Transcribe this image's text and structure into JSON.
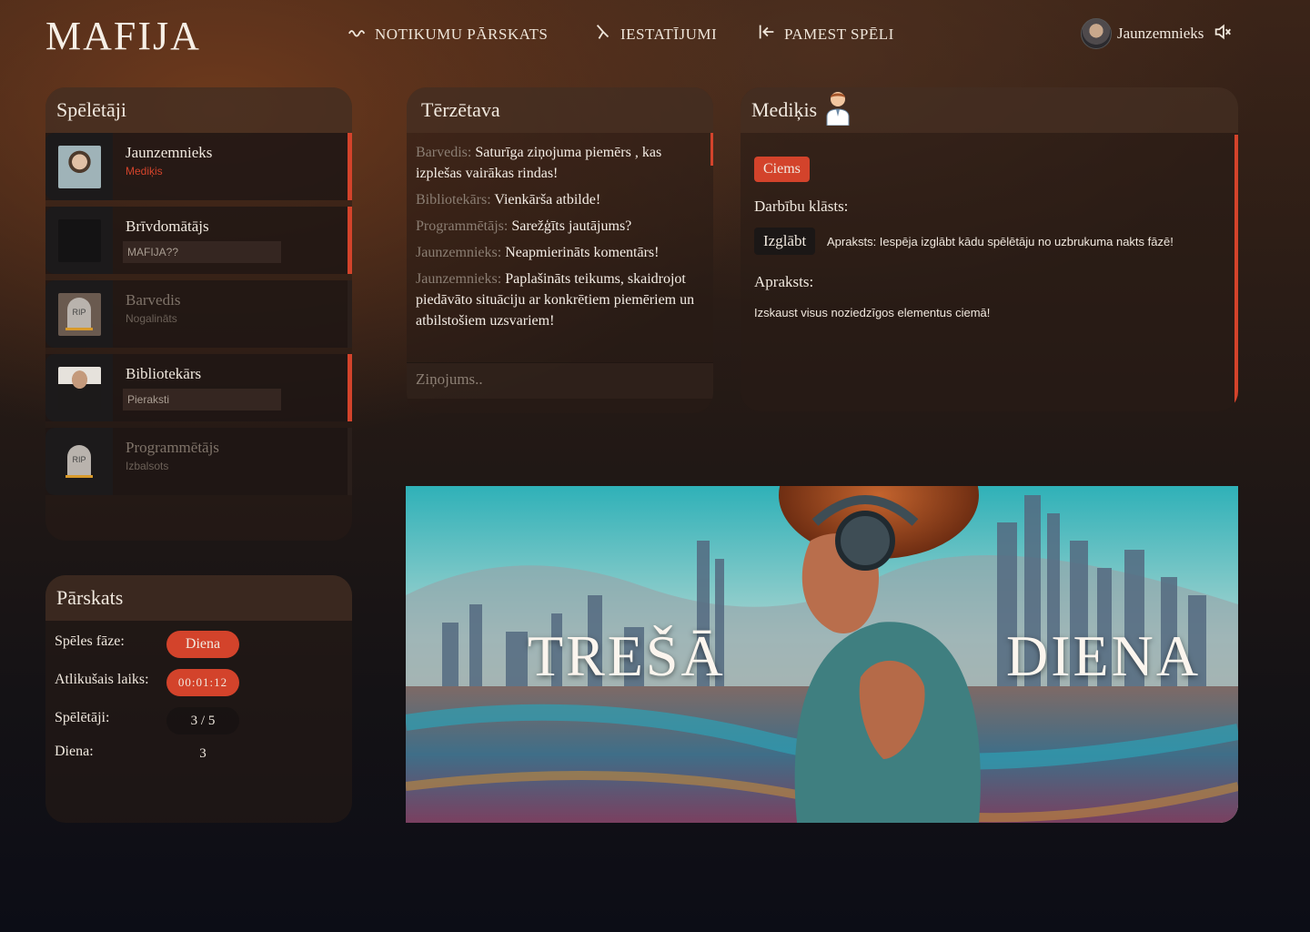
{
  "app": {
    "logo": "MAFIJA"
  },
  "nav": {
    "events_label": "NOTIKUMU PĀRSKATS",
    "settings_label": "IESTATĪJUMI",
    "leave_label": "PAMEST SPĒLI"
  },
  "user": {
    "name": "Jaunzemnieks",
    "sound_icon": "speaker-muted-icon"
  },
  "players_panel": {
    "title": "Spēlētāji",
    "players": [
      {
        "name": "Jaunzemnieks",
        "status": "Mediķis",
        "note": "",
        "state": "self"
      },
      {
        "name": "Brīvdomātājs",
        "status": "",
        "note": "MAFIJA??",
        "state": "alive"
      },
      {
        "name": "Barvedis",
        "status": "Nogalināts",
        "note": "",
        "state": "dead"
      },
      {
        "name": "Bibliotekārs",
        "status": "",
        "note": "Pieraksti",
        "state": "alive"
      },
      {
        "name": "Programmētājs",
        "status": "Izbalsots",
        "note": "",
        "state": "dead"
      }
    ]
  },
  "overview": {
    "title": "Pārskats",
    "phase_label": "Spēles fāze:",
    "phase_value": "Diena",
    "time_label": "Atlikušais laiks:",
    "time_value": "00:01:12",
    "players_label": "Spēlētāji:",
    "players_value": "3 / 5",
    "day_label": "Diena:",
    "day_value": "3"
  },
  "chat": {
    "title": "Tērzētava",
    "messages": [
      {
        "from": "Barvedis:",
        "text": "Saturīga ziņojuma piemērs , kas izplešas vairākas rindas!"
      },
      {
        "from": "Bibliotekārs:",
        "text": "Vienkārša atbilde!"
      },
      {
        "from": "Programmētājs:",
        "text": "Sarežģīts jautājums?"
      },
      {
        "from": "Jaunzemnieks:",
        "text": "Neapmierināts komentārs!"
      },
      {
        "from": "Jaunzemnieks:",
        "text": "Paplašināts teikums, skaidrojot piedāvāto situāciju ar konkrētiem piemēriem un atbilstošiem uzsvariem!"
      }
    ],
    "input_placeholder": "Ziņojums.."
  },
  "role": {
    "title": "Mediķis",
    "icon": "doctor-icon",
    "team_badge": "Ciems",
    "actions_label": "Darbību klāsts:",
    "action_button": "Izglābt",
    "action_desc": "Apraksts: Iespēja izglābt kādu spēlētāju no uzbrukuma nakts fāzē!",
    "desc_label": "Apraksts:",
    "desc_text": "Izskaust visus noziedzīgos elementus ciemā!"
  },
  "banner": {
    "word1": "TREŠĀ",
    "word2": "DIENA"
  },
  "colors": {
    "accent": "#d3432b"
  }
}
